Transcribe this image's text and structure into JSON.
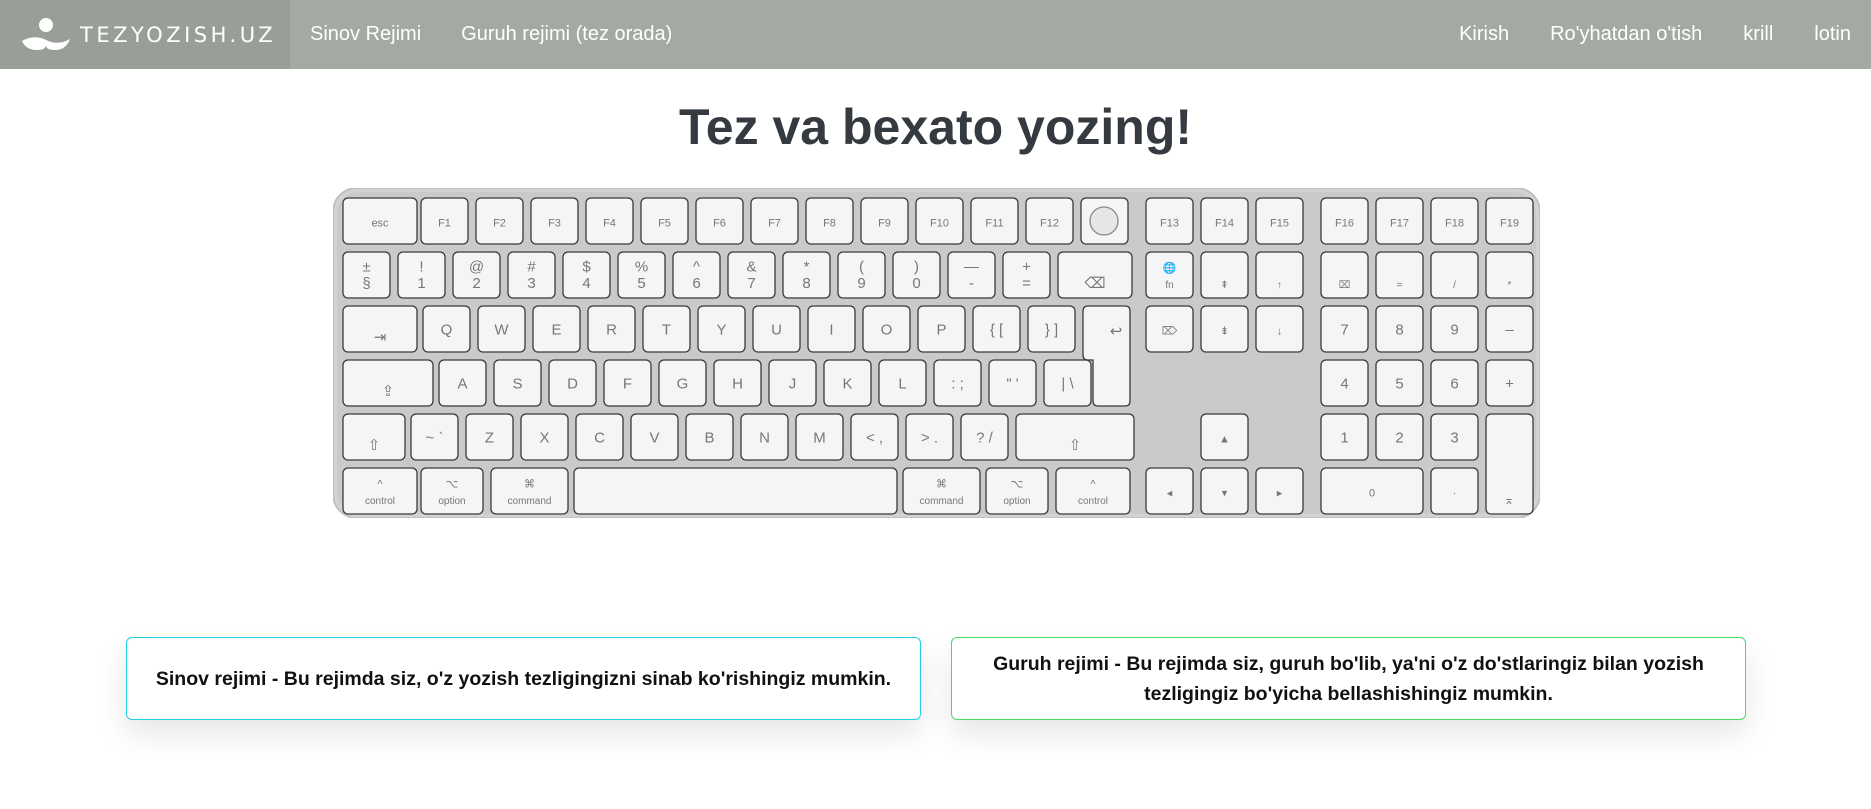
{
  "nav": {
    "brand": "TEZYOZISH.UZ",
    "left_links": [
      "Sinov Rejimi",
      "Guruh rejimi (tez orada)"
    ],
    "right_links": [
      "Kirish",
      "Ro'yhatdan o'tish",
      "krill",
      "lotin"
    ]
  },
  "main": {
    "title": "Tez va bexato yozing!"
  },
  "keyboard": {
    "row_fn": [
      "esc",
      "F1",
      "F2",
      "F3",
      "F4",
      "F5",
      "F6",
      "F7",
      "F8",
      "F9",
      "F10",
      "F11",
      "F12",
      "",
      "F13",
      "F14",
      "F15",
      "F16",
      "F17",
      "F18",
      "F19"
    ],
    "row_num": [
      [
        "±",
        "§"
      ],
      [
        "!",
        "1"
      ],
      [
        "@",
        "2"
      ],
      [
        "#",
        "3"
      ],
      [
        "$",
        "4"
      ],
      [
        "%",
        "5"
      ],
      [
        "^",
        "6"
      ],
      [
        "&",
        "7"
      ],
      [
        "*",
        "8"
      ],
      [
        "(",
        "9"
      ],
      [
        ")",
        "0"
      ],
      [
        "—",
        "-"
      ],
      [
        "+",
        "="
      ],
      [
        "",
        "⌫"
      ],
      [
        "🌐",
        "fn"
      ],
      [
        "",
        "⇞"
      ],
      [
        "",
        "↑"
      ],
      [
        "",
        "⌧"
      ],
      [
        "",
        "="
      ],
      [
        "",
        "/"
      ],
      [
        "",
        "*"
      ]
    ],
    "row_q": [
      "⇥",
      "Q",
      "W",
      "E",
      "R",
      "T",
      "Y",
      "U",
      "I",
      "O",
      "P",
      "{ [",
      "} ]",
      "↩",
      "⌦",
      "⇟",
      "↓",
      "7",
      "8",
      "9",
      "–"
    ],
    "row_a": [
      "⇪",
      "A",
      "S",
      "D",
      "F",
      "G",
      "H",
      "J",
      "K",
      "L",
      ": ;",
      "\" '",
      "| \\",
      "4",
      "5",
      "6",
      "+"
    ],
    "row_z": [
      "⇧",
      "~ `",
      "Z",
      "X",
      "C",
      "V",
      "B",
      "N",
      "M",
      "< ,",
      "> .",
      "? /",
      "⇧",
      "▲",
      "1",
      "2",
      "3"
    ],
    "row_bottom": [
      [
        "^",
        "control"
      ],
      [
        "⌥",
        "option"
      ],
      [
        "⌘",
        "command"
      ],
      [
        "",
        ""
      ],
      [
        "⌘",
        "command"
      ],
      [
        "⌥",
        "option"
      ],
      [
        "^",
        "control"
      ],
      [
        "◂",
        ""
      ],
      [
        "▾",
        ""
      ],
      [
        "▸",
        ""
      ],
      [
        "0",
        ""
      ],
      [
        "·",
        ""
      ],
      [
        "⌅",
        ""
      ]
    ]
  },
  "cards": {
    "sinov": "Sinov rejimi - Bu rejimda siz, o'z yozish tezligingizni sinab ko'rishingiz mumkin.",
    "guruh": "Guruh rejimi - Bu rejimda siz, guruh bo'lib, ya'ni o'z do'stlaringiz bilan yozish tezligingiz bo'yicha bellashishingiz mumkin."
  },
  "colors": {
    "navbar": "#a4aaa3",
    "brand_bg": "#999f98",
    "title": "#343a40",
    "card1_border": "#1dd3e3",
    "card2_border": "#4cd964"
  }
}
